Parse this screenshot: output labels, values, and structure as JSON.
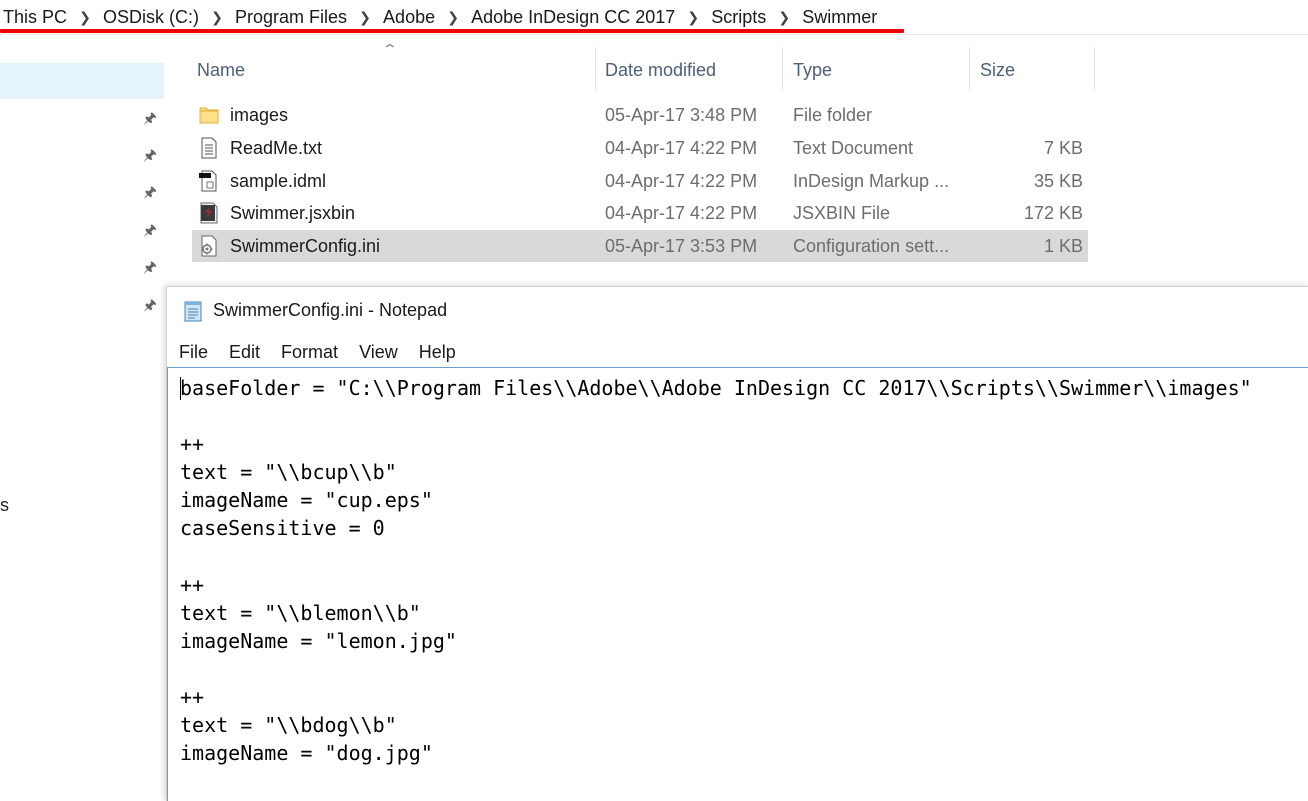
{
  "breadcrumb": {
    "items": [
      "This PC",
      "OSDisk (C:)",
      "Program Files",
      "Adobe",
      "Adobe InDesign CC 2017",
      "Scripts",
      "Swimmer"
    ],
    "separator_icon": "chevron-right-icon",
    "highlight_color": "#ee0000"
  },
  "nav": {
    "fragment_text": "s",
    "selected_color": "#e5f3fb"
  },
  "file_list": {
    "columns": {
      "name": "Name",
      "date_modified": "Date modified",
      "type": "Type",
      "size": "Size"
    },
    "rows": [
      {
        "name": "images",
        "date": "05-Apr-17 3:48 PM",
        "type": "File folder",
        "size": "",
        "icon": "folder-icon",
        "selected": false
      },
      {
        "name": "ReadMe.txt",
        "date": "04-Apr-17 4:22 PM",
        "type": "Text Document",
        "size": "7 KB",
        "icon": "text-document-icon",
        "selected": false
      },
      {
        "name": "sample.idml",
        "date": "04-Apr-17 4:22 PM",
        "type": "InDesign Markup ...",
        "size": "35 KB",
        "icon": "idml-file-icon",
        "selected": false
      },
      {
        "name": "Swimmer.jsxbin",
        "date": "04-Apr-17 4:22 PM",
        "type": "JSXBIN File",
        "size": "172 KB",
        "icon": "jsxbin-file-icon",
        "selected": false
      },
      {
        "name": "SwimmerConfig.ini",
        "date": "05-Apr-17 3:53 PM",
        "type": "Configuration sett...",
        "size": "1 KB",
        "icon": "config-file-icon",
        "selected": true
      }
    ]
  },
  "notepad": {
    "title": "SwimmerConfig.ini - Notepad",
    "menu": [
      "File",
      "Edit",
      "Format",
      "View",
      "Help"
    ],
    "content": "baseFolder = \"C:\\\\Program Files\\\\Adobe\\\\Adobe InDesign CC 2017\\\\Scripts\\\\Swimmer\\\\images\"\n\n++\ntext = \"\\\\bcup\\\\b\"\nimageName = \"cup.eps\"\ncaseSensitive = 0\n\n++\ntext = \"\\\\blemon\\\\b\"\nimageName = \"lemon.jpg\"\n\n++\ntext = \"\\\\bdog\\\\b\"\nimageName = \"dog.jpg\"",
    "editor_border_color": "#6d9ccf"
  }
}
